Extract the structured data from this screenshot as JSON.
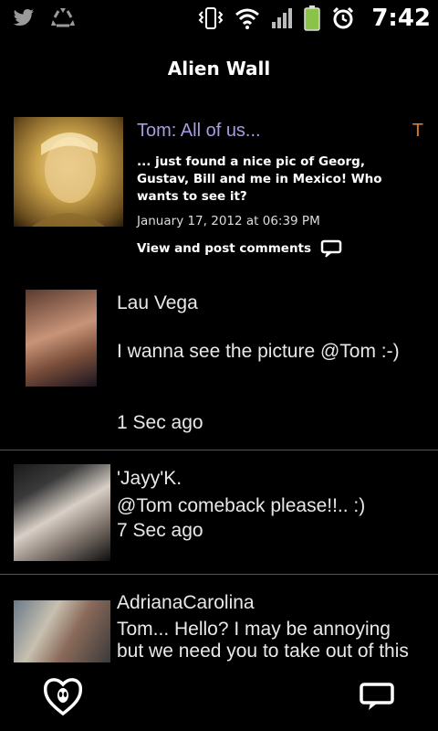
{
  "status_bar": {
    "time": "7:42",
    "icons": [
      "twitter-icon",
      "recycle-icon",
      "vibrate-icon",
      "wifi-icon",
      "signal-icon",
      "battery-icon",
      "alarm-icon"
    ]
  },
  "header": {
    "title": "Alien Wall"
  },
  "post": {
    "author": "Tom: All of us...",
    "marker": "T",
    "body": "... just found a nice pic of Georg, Gustav, Bill and me in Mexico! Who wants to see it?",
    "date": "January 17, 2012 at 06:39 PM",
    "comments_link": "View and post comments"
  },
  "comments": [
    {
      "name": "Lau Vega",
      "text": "I wanna see the picture @Tom :-)",
      "time": "1 Sec ago"
    },
    {
      "name": "'Jayy'K.",
      "text": "@Tom comeback please!!.. :)",
      "time": "7 Sec ago"
    },
    {
      "name": "AdrianaCarolina",
      "text": "Tom... Hello? I may be annoying but we need you to take out of this",
      "time": ""
    }
  ],
  "colors": {
    "background": "#000000",
    "author": "#a79ce0",
    "marker": "#e27a2a",
    "battery": "#8bc34a"
  }
}
